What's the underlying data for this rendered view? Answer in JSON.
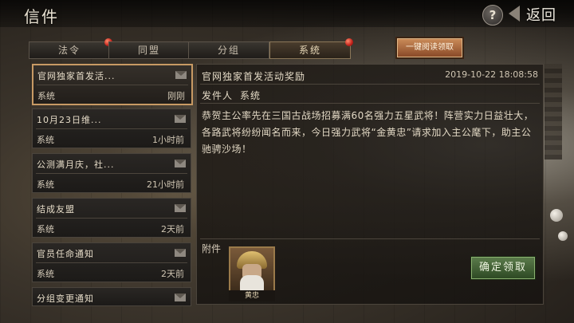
{
  "header": {
    "title": "信件",
    "help_label": "?",
    "back_label": "返回"
  },
  "tabs": [
    {
      "label": "法令",
      "badge": true
    },
    {
      "label": "同盟",
      "badge": false
    },
    {
      "label": "分组",
      "badge": false
    },
    {
      "label": "系统",
      "badge": true,
      "active": true
    }
  ],
  "read_all_label": "一键阅读领取",
  "mail_list": [
    {
      "title": "官网独家首发活...",
      "sender": "系统",
      "time": "刚刚"
    },
    {
      "title": "10月23日维...",
      "sender": "系统",
      "time": "1小时前"
    },
    {
      "title": "公测满月庆，社...",
      "sender": "系统",
      "time": "21小时前"
    },
    {
      "title": "结成友盟",
      "sender": "系统",
      "time": "2天前"
    },
    {
      "title": "官员任命通知",
      "sender": "系统",
      "time": "2天前"
    },
    {
      "title": "分组变更通知",
      "sender": "",
      "time": ""
    }
  ],
  "detail": {
    "title": "官网独家首发活动奖励",
    "date": "2019-10-22 18:08:58",
    "sender_label": "发件人",
    "sender": "系统",
    "body": "恭贺主公率先在三国古战场招募满60名强力五星武将！阵营实力日益壮大，各路武将纷纷闻名而来，今日强力武将“金黄忠”请求加入主公麾下，助主公驰骋沙场！",
    "attachment_label": "附件",
    "attachment_name": "黄忠",
    "confirm_label": "确定领取"
  }
}
